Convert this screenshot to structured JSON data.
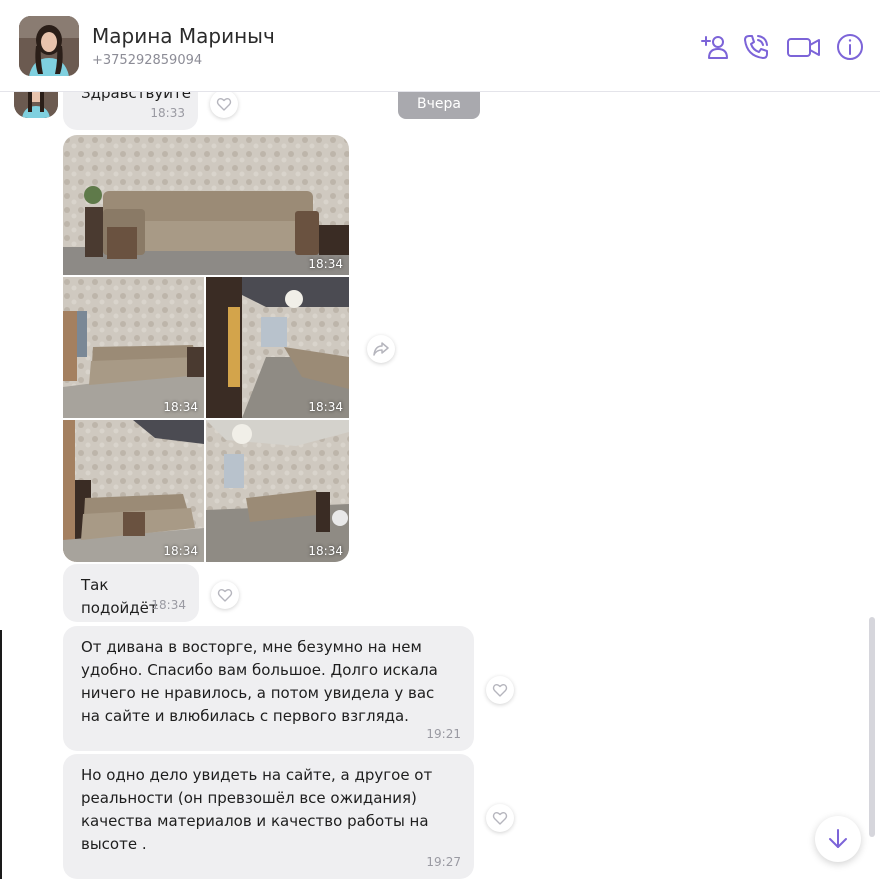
{
  "header": {
    "contact_name": "Марина Мариныч",
    "contact_phone": "+375292859094",
    "icons": [
      "add-contact-icon",
      "phone-call-icon",
      "video-call-icon",
      "info-icon"
    ],
    "accent_color": "#7c64d8"
  },
  "chat": {
    "date_badge": "Вчера",
    "messages": [
      {
        "text": "Здравствуйте",
        "time": "18:33"
      },
      {
        "type": "gallery",
        "photo_times": [
          "18:34",
          "18:34",
          "18:34",
          "18:34",
          "18:34"
        ]
      },
      {
        "text": "Так подойдёт",
        "time": "18:34"
      },
      {
        "text": "От дивана в восторге, мне безумно на нем удобно. Спасибо вам большое. Долго искала ничего не нравилось, а потом увидела у вас на сайте и влюбилась с первого взгляда.",
        "time": "19:21"
      },
      {
        "text": "Но одно дело увидеть на сайте, а другое от реальности (он превзошёл все ожидания) качества материалов и качество работы на высоте .",
        "time": "19:27"
      }
    ]
  }
}
